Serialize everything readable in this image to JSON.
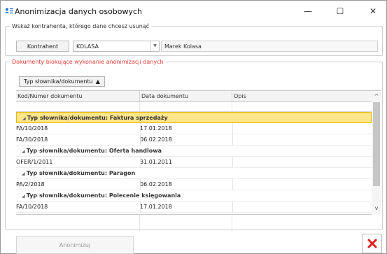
{
  "window": {
    "title": "Anonimizacja danych osobowych",
    "minimize": "—",
    "maximize": "☐",
    "close": "✕",
    "icon": "user-list-icon"
  },
  "contractor_group": {
    "legend": "Wskaż kontrahenta, którego dane chcesz usunąć",
    "button_label": "Kontrahent",
    "code_value": "KOLASA",
    "name_value": "Marek Kolasa"
  },
  "documents_group": {
    "legend": "Dokumenty blokujące wykonanie anonimizacji danych",
    "grouping_chip": "Typ słownika/dokumentu",
    "columns": [
      "Kod/Numer dokumentu",
      "Data dokumentu",
      "Opis"
    ],
    "groups": [
      {
        "label": "Typ słownika/dokumentu: Faktura sprzedaży",
        "selected": true,
        "rows": [
          {
            "code": "FA/10/2018",
            "date": "17.01.2018",
            "desc": ""
          },
          {
            "code": "FA/30/2018",
            "date": "06.02.2018",
            "desc": ""
          }
        ]
      },
      {
        "label": "Typ słownika/dokumentu: Oferta handlowa",
        "selected": false,
        "rows": [
          {
            "code": "OFER/1/2011",
            "date": "31.01.2011",
            "desc": ""
          }
        ]
      },
      {
        "label": "Typ słownika/dokumentu: Paragon",
        "selected": false,
        "rows": [
          {
            "code": "PA/2/2018",
            "date": "06.02.2018",
            "desc": ""
          }
        ]
      },
      {
        "label": "Typ słownika/dokumentu: Polecenie księgowania",
        "selected": false,
        "rows": [
          {
            "code": "FA/10/2018",
            "date": "17.01.2018",
            "desc": ""
          }
        ]
      }
    ]
  },
  "footer": {
    "anonymize_label": "Anonimizuj",
    "close_icon": "red-x-icon",
    "close_color": "#e02020"
  }
}
